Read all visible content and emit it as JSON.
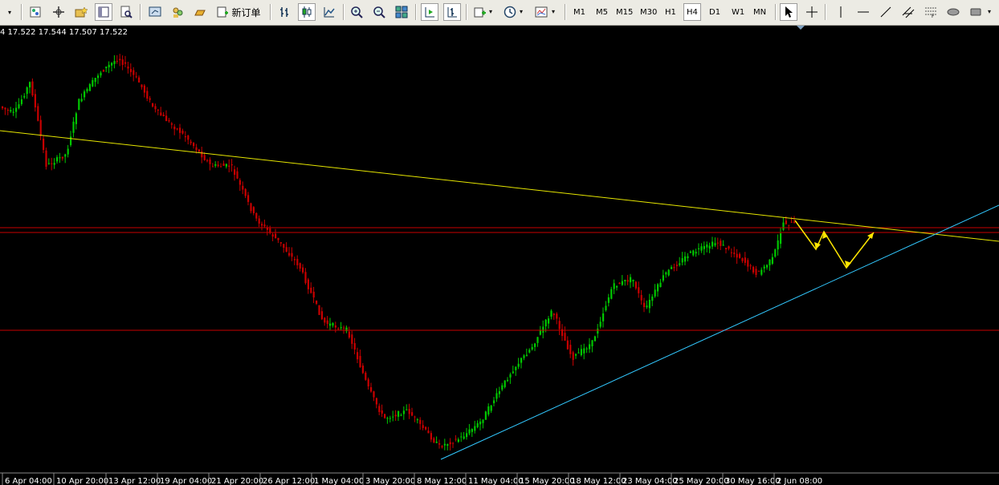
{
  "toolbar": {
    "new_order_label": "新订单",
    "timeframes": [
      "M1",
      "M5",
      "M15",
      "M30",
      "H1",
      "H4",
      "D1",
      "W1",
      "MN"
    ],
    "active_timeframe": "H4"
  },
  "chart": {
    "ohlc_text": "4  17.522 17.544 17.507 17.522",
    "background": "#000000",
    "bull_color": "#00c800",
    "bear_color": "#c80000",
    "downtrend_color": "#e6e600",
    "uptrend_color": "#32c8ff",
    "hline_color": "#c80000",
    "arrow_color": "#ffe600",
    "x_labels": [
      "6 Apr 04:00",
      "10 Apr 20:00",
      "13 Apr 12:00",
      "19 Apr 04:00",
      "21 Apr 20:00",
      "26 Apr 12:00",
      "1 May 04:00",
      "3 May 20:00",
      "8 May 12:00",
      "11 May 04:00",
      "15 May 20:00",
      "18 May 12:00",
      "23 May 04:00",
      "25 May 20:00",
      "30 May 16:00",
      "2 Jun 08:00"
    ]
  }
}
